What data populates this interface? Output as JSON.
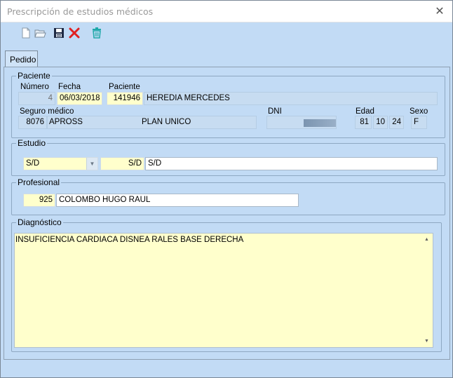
{
  "window": {
    "title": "Prescripción de estudios médicos",
    "close_label": "✕"
  },
  "toolbar": {
    "buttons": [
      {
        "icon": "new-document-icon"
      },
      {
        "icon": "open-folder-icon"
      },
      {
        "icon": "save-icon"
      },
      {
        "icon": "delete-icon"
      },
      {
        "icon": "trash-icon"
      }
    ],
    "colors": {
      "delete": "#e02020",
      "trash": "#1ea8a8"
    }
  },
  "tab": {
    "label": "Pedido"
  },
  "paciente": {
    "group_label": "Paciente",
    "numero_label": "Número",
    "numero": "4",
    "fecha_label": "Fecha",
    "fecha": "06/03/2018",
    "paciente_label": "Paciente",
    "paciente_id": "141946",
    "paciente_nombre": "HEREDIA MERCEDES",
    "seguro_label": "Seguro médico",
    "seguro_id": "8076",
    "seguro_nombre": "APROSS",
    "plan": "PLAN UNICO",
    "dni_label": "DNI",
    "edad_label": "Edad",
    "edad_anios": "81",
    "edad_meses": "10",
    "edad_dias": "24",
    "sexo_label": "Sexo",
    "sexo": "F"
  },
  "estudio": {
    "group_label": "Estudio",
    "tipo": "S/D",
    "codigo": "S/D",
    "descripcion": "S/D"
  },
  "profesional": {
    "group_label": "Profesional",
    "codigo": "925",
    "nombre": "COLOMBO HUGO RAUL"
  },
  "diagnostico": {
    "group_label": "Diagnóstico",
    "texto": "INSUFICIENCIA CARDIACA DISNEA RALES BASE DERECHA"
  },
  "colors": {
    "window_bg": "#c2dbf5",
    "field_yellow": "#ffffcc",
    "field_readonly": "#c7dcf1"
  }
}
